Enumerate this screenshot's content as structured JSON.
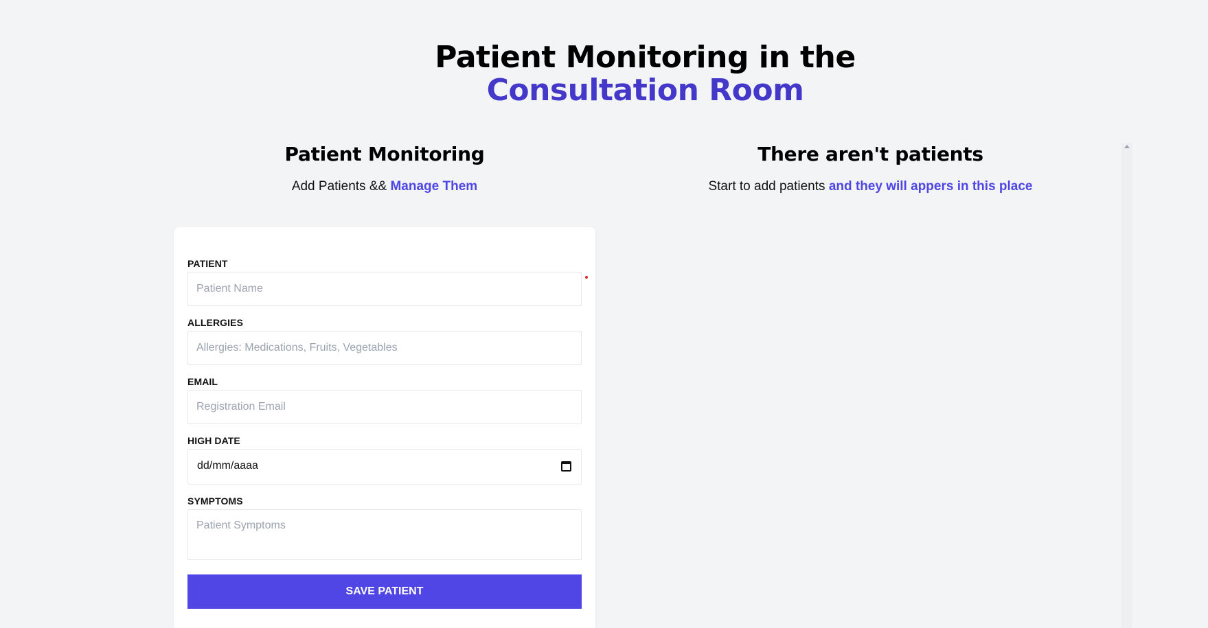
{
  "header": {
    "title_prefix": "Patient Monitoring in the",
    "title_accent": "Consultation Room"
  },
  "left": {
    "title": "Patient Monitoring",
    "subtitle_prefix": "Add Patients &&",
    "subtitle_accent": "Manage Them"
  },
  "right": {
    "title": "There aren't patients",
    "subtitle_prefix": "Start to add patients",
    "subtitle_accent": "and they will appers in this place"
  },
  "form": {
    "patient_label": "Patient",
    "patient_placeholder": "Patient Name",
    "allergies_label": "Allergies",
    "allergies_placeholder": "Allergies: Medications, Fruits, Vegetables",
    "email_label": "Email",
    "email_placeholder": "Registration Email",
    "date_label": "High Date",
    "date_value": "dd/mm/aaaa",
    "symptoms_label": "Symptoms",
    "symptoms_placeholder": "Patient Symptoms",
    "save_label": "Save Patient"
  },
  "colors": {
    "accent": "#4338ca",
    "button": "#4f46e5",
    "background": "#f3f4f6"
  }
}
